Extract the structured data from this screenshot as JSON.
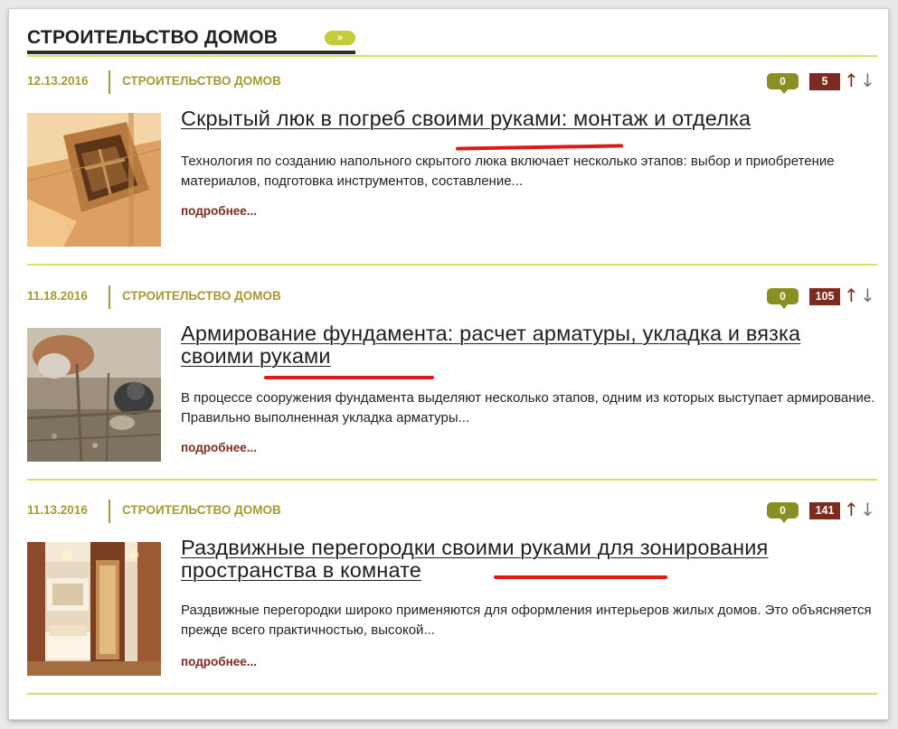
{
  "section": {
    "title": "СТРОИТЕЛЬСТВО ДОМОВ",
    "more_icon": "»"
  },
  "articles": [
    {
      "date": "12.13.2016",
      "category": "СТРОИТЕЛЬСТВО ДОМОВ",
      "comments": "0",
      "rating": "5",
      "vote_up": "↑",
      "vote_down": "↓",
      "title": "Скрытый люк в погреб своими руками: монтаж и отделка",
      "description": "Технология по созданию напольного скрытого люка включает несколько этапов: выбор и приобретение материалов, подготовка инструментов, составление...",
      "more": "подробнее...",
      "thumbnail": "cellar-hatch-photo"
    },
    {
      "date": "11.18.2016",
      "category": "СТРОИТЕЛЬСТВО ДОМОВ",
      "comments": "0",
      "rating": "105",
      "vote_up": "↑",
      "vote_down": "↓",
      "title": "Армирование фундамента: расчет арматуры, укладка и вязка своими руками",
      "description": "В процессе сооружения фундамента выделяют несколько этапов, одним из которых выступает армирование. Правильно выполненная укладка арматуры...",
      "more": "подробнее...",
      "thumbnail": "rebar-tying-photo"
    },
    {
      "date": "11.13.2016",
      "category": "СТРОИТЕЛЬСТВО ДОМОВ",
      "comments": "0",
      "rating": "141",
      "vote_up": "↑",
      "vote_down": "↓",
      "title": "Раздвижные перегородки своими руками для зонирования пространства в комнате",
      "description": "Раздвижные перегородки широко применяются для оформления интерьеров жилых домов. Это объясняется прежде всего практичностью, высокой...",
      "more": "подробнее...",
      "thumbnail": "sliding-partition-photo"
    }
  ],
  "colors": {
    "olive_text": "#a59a35",
    "rule": "#d9dc6a",
    "comment_badge": "#8a8f22",
    "rating_badge": "#7d2a1f",
    "highlight": "#e01818"
  }
}
